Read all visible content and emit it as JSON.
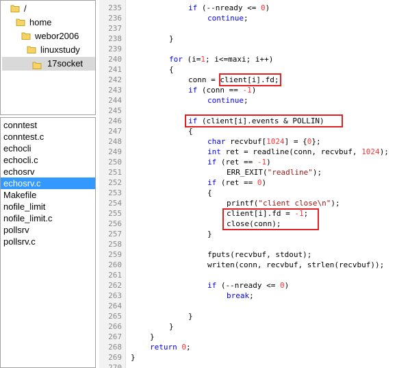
{
  "tree": {
    "nodes": [
      {
        "label": "/",
        "depth": 0,
        "selected": false
      },
      {
        "label": "home",
        "depth": 1,
        "selected": false
      },
      {
        "label": "webor2006",
        "depth": 2,
        "selected": false
      },
      {
        "label": "linuxstudy",
        "depth": 3,
        "selected": false
      },
      {
        "label": "17socket",
        "depth": 4,
        "selected": true
      }
    ]
  },
  "files": [
    {
      "label": "conntest",
      "selected": false
    },
    {
      "label": "conntest.c",
      "selected": false
    },
    {
      "label": "echocli",
      "selected": false
    },
    {
      "label": "echocli.c",
      "selected": false
    },
    {
      "label": "echosrv",
      "selected": false
    },
    {
      "label": "echosrv.c",
      "selected": true
    },
    {
      "label": "Makefile",
      "selected": false
    },
    {
      "label": "nofile_limit",
      "selected": false
    },
    {
      "label": "nofile_limit.c",
      "selected": false
    },
    {
      "label": "pollsrv",
      "selected": false
    },
    {
      "label": "pollsrv.c",
      "selected": false
    }
  ],
  "editor": {
    "lines": [
      {
        "num": "235",
        "indent": 6,
        "parts": [
          {
            "t": "if",
            "c": "kw"
          },
          {
            "t": " (--nready <= ",
            "c": ""
          },
          {
            "t": "0",
            "c": "num"
          },
          {
            "t": ")",
            "c": ""
          }
        ]
      },
      {
        "num": "236",
        "indent": 8,
        "parts": [
          {
            "t": "continue",
            "c": "kw"
          },
          {
            "t": ";",
            "c": ""
          }
        ]
      },
      {
        "num": "237",
        "indent": 0,
        "parts": []
      },
      {
        "num": "238",
        "indent": 4,
        "parts": [
          {
            "t": "}",
            "c": ""
          }
        ]
      },
      {
        "num": "239",
        "indent": 0,
        "parts": []
      },
      {
        "num": "240",
        "indent": 4,
        "parts": [
          {
            "t": "for",
            "c": "kw"
          },
          {
            "t": " (i=",
            "c": ""
          },
          {
            "t": "1",
            "c": "num"
          },
          {
            "t": "; i<=maxi; i++)",
            "c": ""
          }
        ]
      },
      {
        "num": "241",
        "indent": 4,
        "parts": [
          {
            "t": "{",
            "c": ""
          }
        ]
      },
      {
        "num": "242",
        "indent": 6,
        "parts": [
          {
            "t": "conn = client[i].fd;",
            "c": ""
          }
        ]
      },
      {
        "num": "243",
        "indent": 6,
        "parts": [
          {
            "t": "if",
            "c": "kw"
          },
          {
            "t": " (conn == ",
            "c": ""
          },
          {
            "t": "-1",
            "c": "num"
          },
          {
            "t": ")",
            "c": ""
          }
        ]
      },
      {
        "num": "244",
        "indent": 8,
        "parts": [
          {
            "t": "continue",
            "c": "kw"
          },
          {
            "t": ";",
            "c": ""
          }
        ]
      },
      {
        "num": "245",
        "indent": 0,
        "parts": []
      },
      {
        "num": "246",
        "indent": 6,
        "parts": [
          {
            "t": "if",
            "c": "kw"
          },
          {
            "t": " (client[i].events & POLLIN)",
            "c": ""
          }
        ]
      },
      {
        "num": "247",
        "indent": 6,
        "parts": [
          {
            "t": "{",
            "c": ""
          }
        ]
      },
      {
        "num": "248",
        "indent": 8,
        "parts": [
          {
            "t": "char",
            "c": "kw"
          },
          {
            "t": " recvbuf[",
            "c": ""
          },
          {
            "t": "1024",
            "c": "num"
          },
          {
            "t": "] = {",
            "c": ""
          },
          {
            "t": "0",
            "c": "num"
          },
          {
            "t": "};",
            "c": ""
          }
        ]
      },
      {
        "num": "249",
        "indent": 8,
        "parts": [
          {
            "t": "int",
            "c": "kw"
          },
          {
            "t": " ret = readline(conn, recvbuf, ",
            "c": ""
          },
          {
            "t": "1024",
            "c": "num"
          },
          {
            "t": ");",
            "c": ""
          }
        ]
      },
      {
        "num": "250",
        "indent": 8,
        "parts": [
          {
            "t": "if",
            "c": "kw"
          },
          {
            "t": " (ret == ",
            "c": ""
          },
          {
            "t": "-1",
            "c": "num"
          },
          {
            "t": ")",
            "c": ""
          }
        ]
      },
      {
        "num": "251",
        "indent": 10,
        "parts": [
          {
            "t": "ERR_EXIT(",
            "c": ""
          },
          {
            "t": "\"readline\"",
            "c": "str"
          },
          {
            "t": ");",
            "c": ""
          }
        ]
      },
      {
        "num": "252",
        "indent": 8,
        "parts": [
          {
            "t": "if",
            "c": "kw"
          },
          {
            "t": " (ret == ",
            "c": ""
          },
          {
            "t": "0",
            "c": "num"
          },
          {
            "t": ")",
            "c": ""
          }
        ]
      },
      {
        "num": "253",
        "indent": 8,
        "parts": [
          {
            "t": "{",
            "c": ""
          }
        ]
      },
      {
        "num": "254",
        "indent": 10,
        "parts": [
          {
            "t": "printf(",
            "c": ""
          },
          {
            "t": "\"client close\\n\"",
            "c": "str"
          },
          {
            "t": ");",
            "c": ""
          }
        ]
      },
      {
        "num": "255",
        "indent": 10,
        "parts": [
          {
            "t": "client[i].fd = ",
            "c": ""
          },
          {
            "t": "-1",
            "c": "num"
          },
          {
            "t": ";",
            "c": ""
          }
        ]
      },
      {
        "num": "256",
        "indent": 10,
        "parts": [
          {
            "t": "close(conn);",
            "c": ""
          }
        ]
      },
      {
        "num": "257",
        "indent": 8,
        "parts": [
          {
            "t": "}",
            "c": ""
          }
        ]
      },
      {
        "num": "258",
        "indent": 0,
        "parts": []
      },
      {
        "num": "259",
        "indent": 8,
        "parts": [
          {
            "t": "fputs(recvbuf, stdout);",
            "c": ""
          }
        ]
      },
      {
        "num": "260",
        "indent": 8,
        "parts": [
          {
            "t": "writen(conn, recvbuf, strlen(recvbuf));",
            "c": ""
          }
        ]
      },
      {
        "num": "261",
        "indent": 0,
        "parts": []
      },
      {
        "num": "262",
        "indent": 8,
        "parts": [
          {
            "t": "if",
            "c": "kw"
          },
          {
            "t": " (--nready <= ",
            "c": ""
          },
          {
            "t": "0",
            "c": "num"
          },
          {
            "t": ")",
            "c": ""
          }
        ]
      },
      {
        "num": "263",
        "indent": 10,
        "parts": [
          {
            "t": "break",
            "c": "kw"
          },
          {
            "t": ";",
            "c": ""
          }
        ]
      },
      {
        "num": "264",
        "indent": 0,
        "parts": []
      },
      {
        "num": "265",
        "indent": 6,
        "parts": [
          {
            "t": "}",
            "c": ""
          }
        ]
      },
      {
        "num": "266",
        "indent": 4,
        "parts": [
          {
            "t": "}",
            "c": ""
          }
        ]
      },
      {
        "num": "267",
        "indent": 2,
        "parts": [
          {
            "t": "}",
            "c": ""
          }
        ]
      },
      {
        "num": "268",
        "indent": 2,
        "parts": [
          {
            "t": "return",
            "c": "kw"
          },
          {
            "t": " ",
            "c": ""
          },
          {
            "t": "0",
            "c": "num"
          },
          {
            "t": ";",
            "c": ""
          }
        ]
      },
      {
        "num": "269",
        "indent": 0,
        "parts": [
          {
            "t": "}",
            "c": ""
          }
        ]
      },
      {
        "num": "270",
        "indent": 0,
        "parts": []
      }
    ],
    "highlight_color": "#e02020"
  }
}
